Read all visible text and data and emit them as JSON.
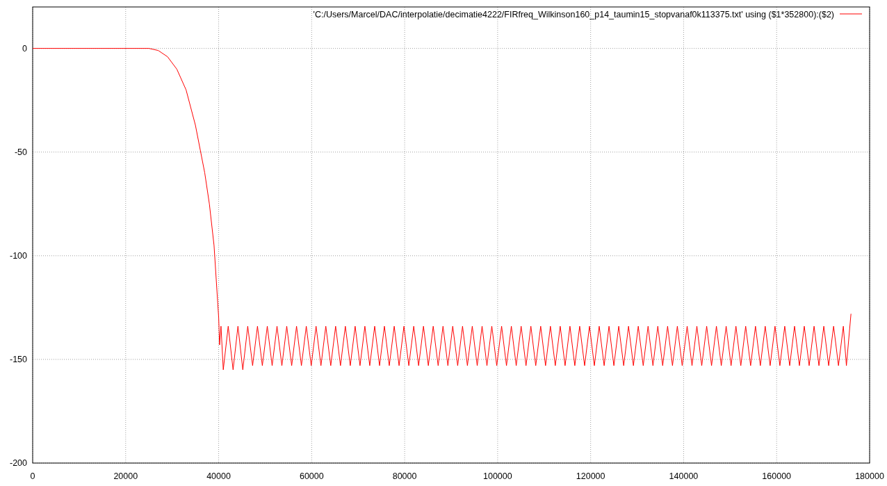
{
  "chart_data": {
    "type": "line",
    "grid": true,
    "xlim": [
      0,
      180000
    ],
    "ylim": [
      -200,
      20
    ],
    "xticks": [
      0,
      20000,
      40000,
      60000,
      80000,
      100000,
      120000,
      140000,
      160000,
      180000
    ],
    "yticks": [
      -200,
      -150,
      -100,
      -50,
      0
    ],
    "x": [
      0,
      25000,
      27000,
      29000,
      31000,
      33000,
      35000,
      37000,
      38000,
      39000,
      40000,
      40200,
      40500,
      41000,
      42050,
      43100,
      44150,
      45200,
      46250,
      47300,
      48350,
      49400,
      50450,
      51500,
      52550,
      53600,
      54650,
      55700,
      56750,
      57800,
      58850,
      59900,
      60950,
      62000,
      63050,
      64100,
      65150,
      66200,
      67250,
      68300,
      69350,
      70400,
      71450,
      72500,
      73550,
      74600,
      75650,
      76700,
      77750,
      78800,
      79850,
      80900,
      81950,
      83000,
      84050,
      85100,
      86150,
      87200,
      88250,
      89300,
      90350,
      91400,
      92450,
      93500,
      94550,
      95600,
      96650,
      97700,
      98750,
      99800,
      100850,
      101900,
      102950,
      104000,
      105050,
      106100,
      107150,
      108200,
      109250,
      110300,
      111350,
      112400,
      113450,
      114500,
      115550,
      116600,
      117650,
      118700,
      119750,
      120800,
      121850,
      122900,
      123950,
      125000,
      126050,
      127100,
      128150,
      129200,
      130250,
      131300,
      132350,
      133400,
      134450,
      135500,
      136550,
      137600,
      138650,
      139700,
      140750,
      141800,
      142850,
      143900,
      144950,
      146000,
      147050,
      148100,
      149150,
      150200,
      151250,
      152300,
      153350,
      154400,
      155450,
      156500,
      157550,
      158600,
      159650,
      160700,
      161750,
      162800,
      163850,
      164900,
      165950,
      167000,
      168050,
      169100,
      170150,
      171200,
      172250,
      173300,
      174350,
      175000,
      176000
    ],
    "series": [
      {
        "name": "'C:/Users/Marcel/DAC/interpolatie/decimatie4222/FIRfreq_Wilkinson160_p14_taumin15_stopvanaf0k113375.txt' using ($1*352800):($2)",
        "color": "#ff0000",
        "values": [
          0,
          0,
          -1,
          -4,
          -10,
          -20,
          -37,
          -60,
          -75,
          -95,
          -130,
          -143,
          -134,
          -155,
          -134,
          -155,
          -134,
          -155,
          -134,
          -153,
          -134,
          -153,
          -134,
          -153,
          -134,
          -153,
          -134,
          -153,
          -134,
          -153,
          -134,
          -153,
          -134,
          -153,
          -134,
          -153,
          -134,
          -153,
          -134,
          -153,
          -134,
          -153,
          -134,
          -153,
          -134,
          -153,
          -134,
          -153,
          -134,
          -153,
          -134,
          -153,
          -134,
          -153,
          -134,
          -153,
          -134,
          -153,
          -134,
          -153,
          -134,
          -153,
          -134,
          -153,
          -134,
          -153,
          -134,
          -153,
          -134,
          -153,
          -134,
          -153,
          -134,
          -153,
          -134,
          -153,
          -134,
          -153,
          -134,
          -153,
          -134,
          -153,
          -134,
          -153,
          -134,
          -153,
          -134,
          -153,
          -134,
          -153,
          -134,
          -153,
          -134,
          -153,
          -134,
          -153,
          -134,
          -153,
          -134,
          -153,
          -134,
          -153,
          -134,
          -153,
          -134,
          -153,
          -134,
          -153,
          -134,
          -153,
          -134,
          -153,
          -134,
          -153,
          -134,
          -153,
          -134,
          -153,
          -134,
          -153,
          -134,
          -153,
          -134,
          -153,
          -134,
          -153,
          -134,
          -153,
          -134,
          -153,
          -134,
          -153,
          -134,
          -153,
          -134,
          -153,
          -134,
          -153,
          -134,
          -153,
          -134,
          -153,
          -128
        ]
      }
    ]
  }
}
